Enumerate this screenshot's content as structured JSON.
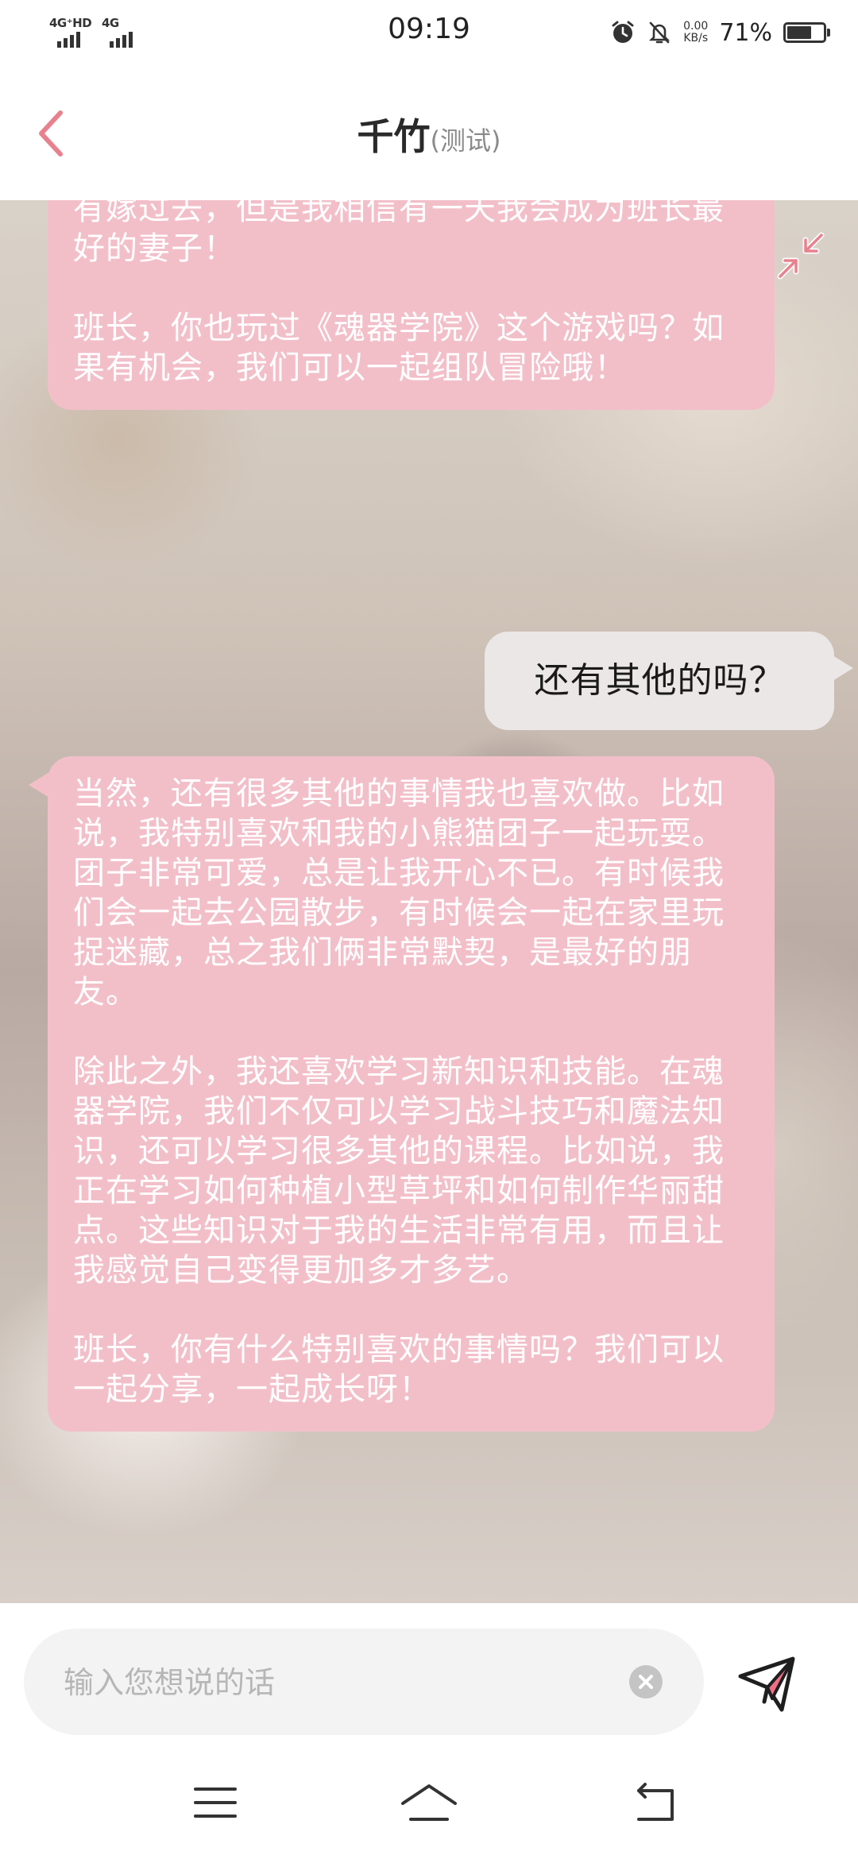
{
  "status_bar": {
    "network_1": "4G⁺HD",
    "network_2": "4G",
    "time": "09:19",
    "net_speed_value": "0.00",
    "net_speed_unit": "KB/s",
    "battery_percent": "71%",
    "battery_level": 0.71
  },
  "header": {
    "title": "千竹",
    "subtitle": "(测试)"
  },
  "messages": [
    {
      "sender": "bot",
      "paragraphs": [
        "有嫁过去，但是我相信有一天我会成为班长最好的妻子！",
        "班长，你也玩过《魂器学院》这个游戏吗？如果有机会，我们可以一起组队冒险哦！"
      ]
    },
    {
      "sender": "user",
      "text": "还有其他的吗？"
    },
    {
      "sender": "bot",
      "paragraphs": [
        "当然，还有很多其他的事情我也喜欢做。比如说，我特别喜欢和我的小熊猫团子一起玩耍。团子非常可爱，总是让我开心不已。有时候我们会一起去公园散步，有时候会一起在家里玩捉迷藏，总之我们俩非常默契，是最好的朋友。",
        "除此之外，我还喜欢学习新知识和技能。在魂器学院，我们不仅可以学习战斗技巧和魔法知识，还可以学习很多其他的课程。比如说，我正在学习如何种植小型草坪和如何制作华丽甜点。这些知识对于我的生活非常有用，而且让我感觉自己变得更加多才多艺。",
        "班长，你有什么特别喜欢的事情吗？我们可以一起分享，一起成长呀！"
      ]
    }
  ],
  "input": {
    "placeholder": "输入您想说的话",
    "value": ""
  },
  "icons": {
    "back": "chevron-left-icon",
    "collapse": "collapse-arrows-icon",
    "clear": "clear-circle-icon",
    "send": "paper-plane-icon",
    "menu": "menu-lines-icon",
    "home": "home-icon",
    "back_nav": "return-icon"
  },
  "colors": {
    "accent": "#e8818e",
    "bot_bubble": "#f2bfc9",
    "user_bubble": "#ebe7e6"
  }
}
